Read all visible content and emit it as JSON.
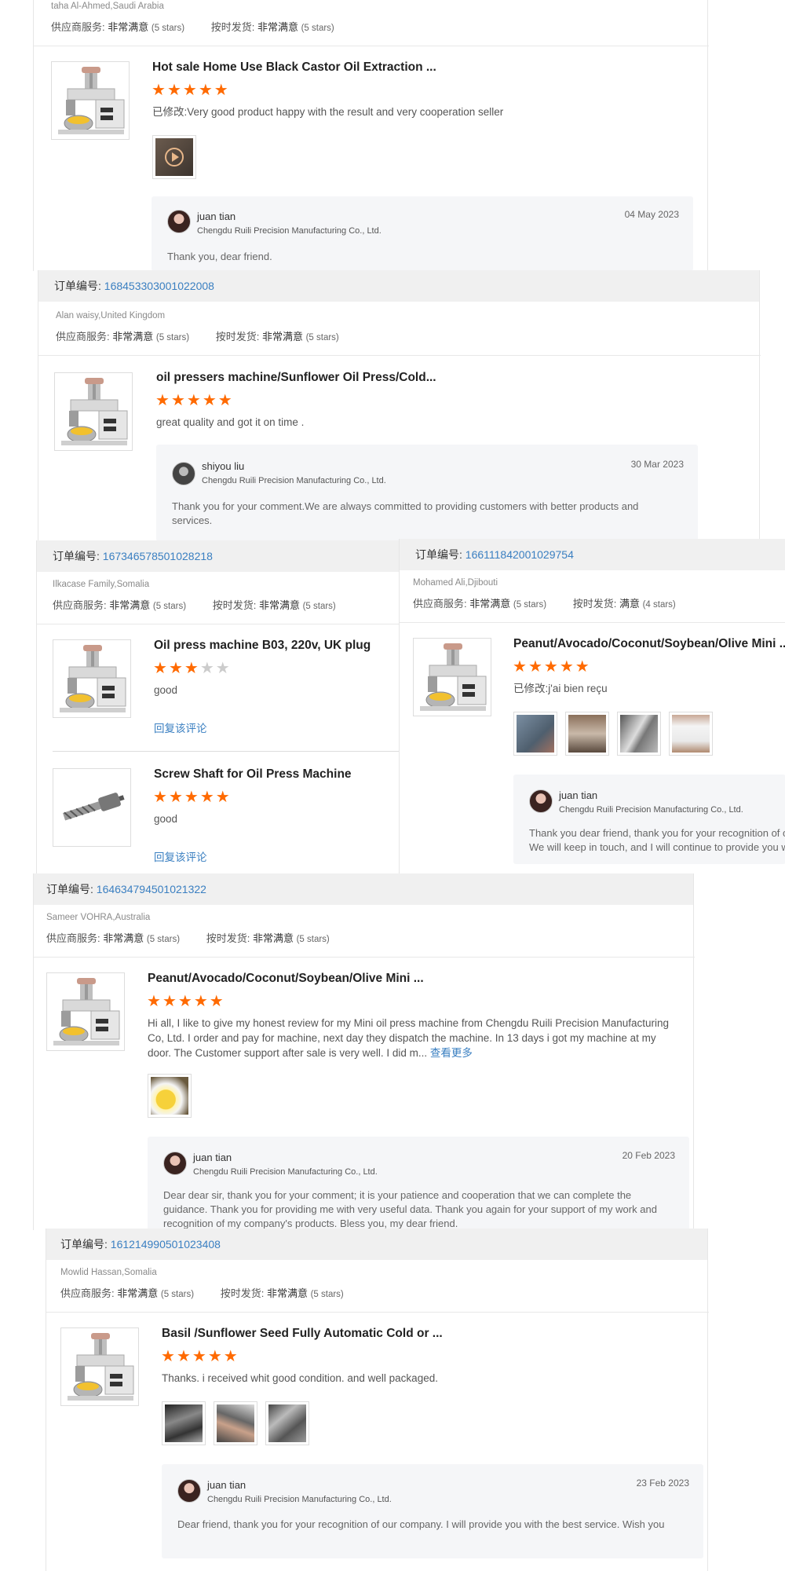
{
  "labels": {
    "order_no": "订单编号:",
    "supplier_service": "供应商服务:",
    "on_time_shipping": "按时发货:",
    "reply_link": "回复该评论",
    "modified": "已修改:",
    "see_more": "查看更多"
  },
  "block1": {
    "buyer": "taha Al-Ahmed,Saudi Arabia",
    "supplier_rating": "非常满意",
    "supplier_stars": "(5 stars)",
    "shipping_rating": "非常满意",
    "shipping_stars": "(5 stars)",
    "product_title": "Hot sale Home Use Black Castor Oil Extraction ...",
    "rating": 5,
    "review": "Very good product happy with the result and very cooperation seller",
    "reply": {
      "name": "juan tian",
      "company": "Chengdu Ruili Precision Manufacturing Co., Ltd.",
      "date": "04 May 2023",
      "text": "Thank you, dear friend."
    }
  },
  "block2": {
    "order_number": "168453303001022008",
    "buyer": "Alan waisy,United Kingdom",
    "supplier_rating": "非常满意",
    "supplier_stars": "(5 stars)",
    "shipping_rating": "非常满意",
    "shipping_stars": "(5 stars)",
    "product_title": "oil pressers machine/Sunflower Oil Press/Cold...",
    "rating": 5,
    "review": "great quality and got it on time .",
    "reply": {
      "name": "shiyou liu",
      "company": "Chengdu Ruili Precision Manufacturing Co., Ltd.",
      "date": "30 Mar 2023",
      "text": "Thank you for your comment.We are always committed to providing customers with better products and services."
    }
  },
  "block3": {
    "order_number": "167346578501028218",
    "buyer": "Ilkacase Family,Somalia",
    "supplier_rating": "非常满意",
    "supplier_stars": "(5 stars)",
    "shipping_rating": "非常满意",
    "shipping_stars": "(5 stars)",
    "items": [
      {
        "product_title": "Oil press machine B03, 220v, UK plug",
        "rating": 3,
        "review": "good"
      },
      {
        "product_title": "Screw Shaft for Oil Press Machine",
        "rating": 5,
        "review": "good"
      }
    ]
  },
  "block4": {
    "order_number": "166111842001029754",
    "buyer": "Mohamed Ali,Djibouti",
    "supplier_rating": "非常满意",
    "supplier_stars": "(5 stars)",
    "shipping_rating": "满意",
    "shipping_stars": "(4 stars)",
    "product_title": "Peanut/Avocado/Coconut/Soybean/Olive Mini ...",
    "rating": 5,
    "review": "j'ai bien reçu",
    "reply": {
      "name": "juan tian",
      "company": "Chengdu Ruili Precision Manufacturing Co., Ltd.",
      "text": "Thank you dear friend, thank you for your recognition of our company. We will keep in touch, and I will continue to provide you with high-quality service."
    }
  },
  "block5": {
    "order_number": "164634794501021322",
    "buyer": "Sameer VOHRA,Australia",
    "supplier_rating": "非常满意",
    "supplier_stars": "(5 stars)",
    "shipping_rating": "非常满意",
    "shipping_stars": "(5 stars)",
    "product_title": "Peanut/Avocado/Coconut/Soybean/Olive Mini ...",
    "rating": 5,
    "review": "Hi all, I like to give my honest review for my Mini oil press machine from Chengdu Ruili Precision Manufacturing Co, Ltd. I order and pay for machine, next day they dispatch the machine. In 13 days i got my machine at my door. The Customer support after sale is very well. I did m...",
    "reply": {
      "name": "juan tian",
      "company": "Chengdu Ruili Precision Manufacturing Co., Ltd.",
      "date": "20 Feb 2023",
      "text": "Dear dear sir, thank you for your comment; it is your patience and cooperation that we can complete the guidance. Thank you for providing me with very useful data. Thank you again for your support of my work and recognition of my company's products. Bless you, my dear friend."
    }
  },
  "block6": {
    "order_number": "161214990501023408",
    "buyer": "Mowlid Hassan,Somalia",
    "supplier_rating": "非常满意",
    "supplier_stars": "(5 stars)",
    "shipping_rating": "非常满意",
    "shipping_stars": "(5 stars)",
    "product_title": "Basil /Sunflower Seed Fully Automatic Cold or ...",
    "rating": 5,
    "review": "Thanks. i received whit good condition. and well packaged.",
    "reply": {
      "name": "juan tian",
      "company": "Chengdu Ruili Precision Manufacturing Co., Ltd.",
      "date": "23 Feb 2023",
      "text": "Dear friend, thank you for your recognition of our company. I will provide you with the best service. Wish you"
    }
  },
  "colors": {
    "accent_orange": "#ff6a00",
    "link_blue": "#3a7fc1",
    "order_bar": "#f0f0f0",
    "reply_bg": "#f5f6f8"
  }
}
